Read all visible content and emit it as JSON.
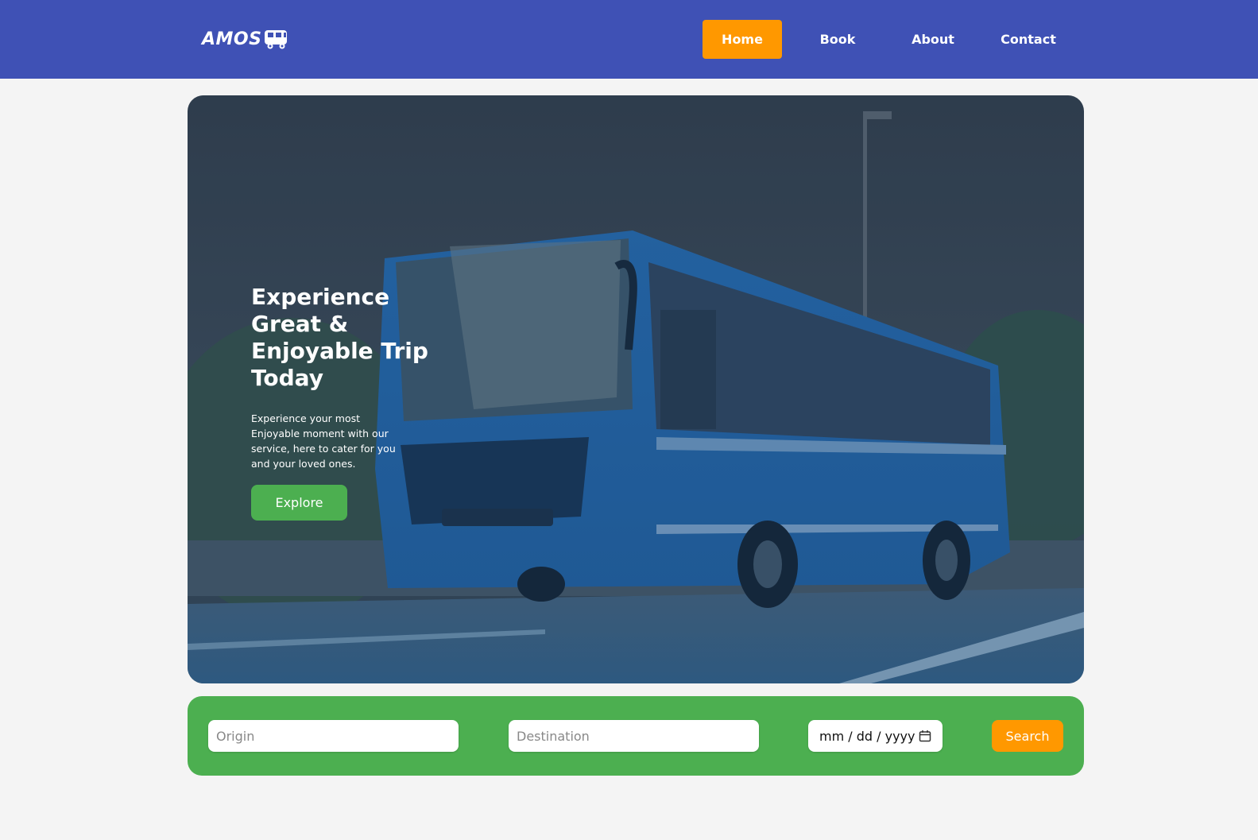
{
  "brand": {
    "name": "AMOS",
    "icon": "bus-icon"
  },
  "nav": {
    "items": [
      {
        "label": "Home",
        "active": true
      },
      {
        "label": "Book",
        "active": false
      },
      {
        "label": "About",
        "active": false
      },
      {
        "label": "Contact",
        "active": false
      }
    ]
  },
  "hero": {
    "title": "Experience Great & Enjoyable Trip Today",
    "subtitle": "Experience your most Enjoyable moment with our service, here to cater for you and your loved ones.",
    "button_label": "Explore"
  },
  "search": {
    "origin_placeholder": "Origin",
    "destination_placeholder": "Destination",
    "date_placeholder": "mm / dd / yyyy",
    "date_icon": "calendar-icon",
    "button_label": "Search"
  },
  "colors": {
    "nav_bg": "#3f51b5",
    "accent": "#ff9800",
    "green": "#4caf50",
    "page_bg": "#f4f4f4"
  }
}
